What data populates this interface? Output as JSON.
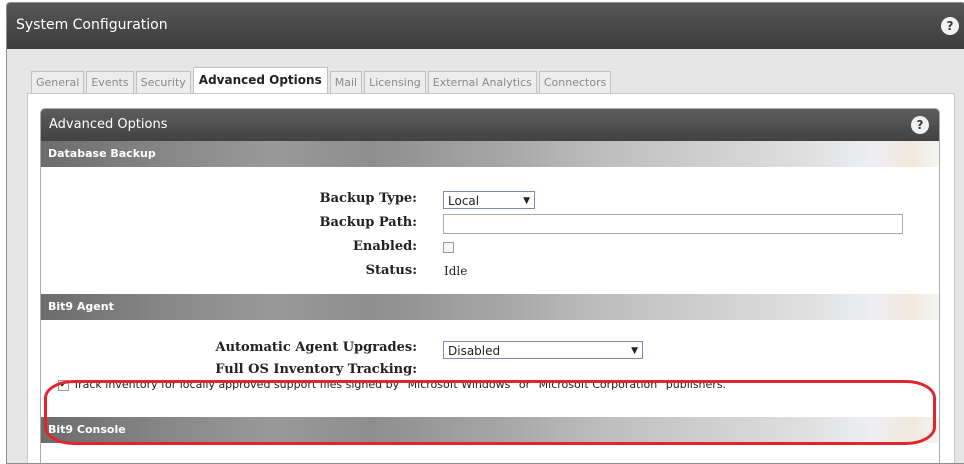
{
  "window": {
    "title": "System Configuration",
    "help": "?"
  },
  "tabs": [
    "General",
    "Events",
    "Security",
    "Advanced Options",
    "Mail",
    "Licensing",
    "External Analytics",
    "Connectors"
  ],
  "panel": {
    "title": "Advanced Options",
    "help": "?"
  },
  "database_backup": {
    "heading": "Database Backup",
    "backup_type_label": "Backup Type:",
    "backup_type_value": "Local",
    "backup_path_label": "Backup Path:",
    "backup_path_value": "",
    "enabled_label": "Enabled:",
    "enabled_checked": false,
    "status_label": "Status:",
    "status_value": "Idle"
  },
  "agent": {
    "heading": "Bit9 Agent",
    "upgrades_label": "Automatic Agent Upgrades:",
    "upgrades_value": "Disabled",
    "inventory_label": "Full OS Inventory Tracking:",
    "inventory_checked": true,
    "inventory_text": "Track inventory for locally approved support files signed by \"Microsoft Windows\" or \"Microsoft Corporation\" publishers."
  },
  "console": {
    "heading": "Bit9 Console"
  },
  "colors": {
    "title_bar": "#474747",
    "highlight": "#e0262b"
  },
  "icons": {
    "dropdown": "▼",
    "checkmark": "✔"
  }
}
